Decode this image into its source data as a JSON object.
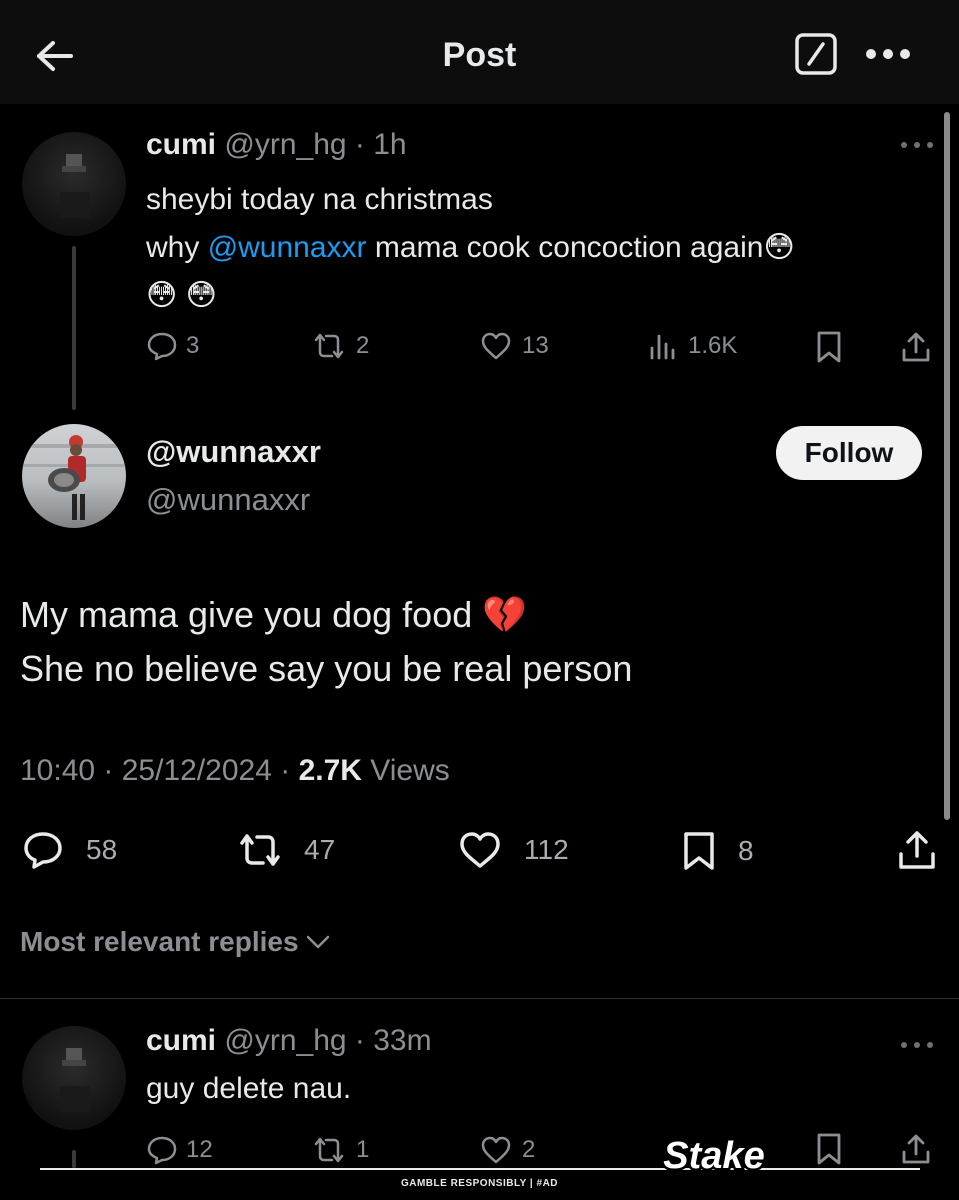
{
  "header": {
    "title": "Post",
    "back_icon": "arrow-left-icon",
    "edit_icon": "compose-icon",
    "more_icon": "more-dots-icon"
  },
  "parent_tweet": {
    "name": "cumi",
    "handle": "@yrn_hg",
    "time": "1h",
    "line1": "sheybi today na christmas",
    "line2_pre": "why ",
    "mention": "@wunnaxxr",
    "line2_post": " mama cook concoction again",
    "emoji_trail": "😳",
    "emoji_line3": "😳 😳",
    "replies": "3",
    "reposts": "2",
    "likes": "13",
    "views": "1.6K"
  },
  "main_tweet": {
    "display_name": "@wunnaxxr",
    "handle": "@wunnaxxr",
    "follow_label": "Follow",
    "line1": "My mama give you dog food ",
    "line1_emoji": "💔",
    "line2": "She no believe say you be real person",
    "time": "10:40",
    "date": "25/12/2024",
    "views_count": "2.7K",
    "views_label": "Views",
    "replies": "58",
    "reposts": "47",
    "likes": "112",
    "bookmarks": "8"
  },
  "sort": {
    "label": "Most relevant replies"
  },
  "reply_tweet": {
    "name": "cumi",
    "handle": "@yrn_hg",
    "time": "33m",
    "text": "guy delete nau.",
    "replies": "12",
    "reposts": "1",
    "likes": "2"
  },
  "ad": {
    "brand": "Stake",
    "disclaimer": "GAMBLE RESPONSIBLY | #AD"
  },
  "colors": {
    "background": "#000000",
    "text": "#e7e9ea",
    "secondary": "#8b8f94",
    "accent": "#1d9bf0"
  }
}
